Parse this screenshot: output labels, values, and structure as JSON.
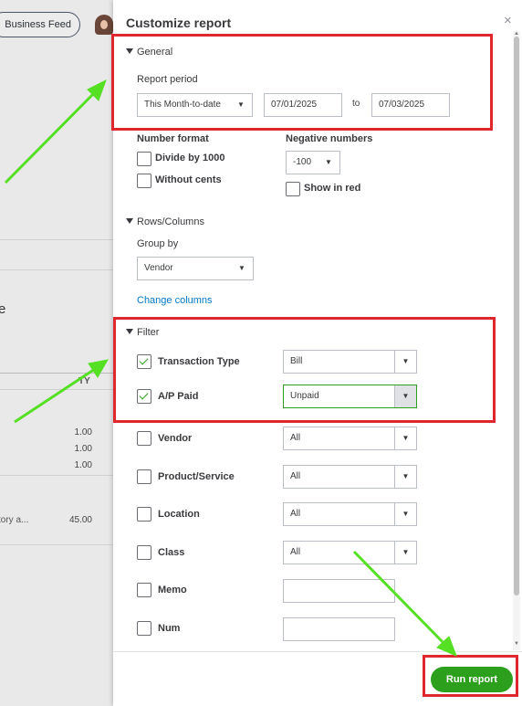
{
  "background": {
    "business_feed_label": "Business Feed",
    "partial_letter": "e",
    "column_header_partial": "TY",
    "row_values": [
      "1.00",
      "1.00",
      "1.00"
    ],
    "row_label_partial": "tory a...",
    "row_value": "45.00"
  },
  "panel": {
    "title": "Customize report",
    "close_label": "×",
    "general": {
      "section_label": "General",
      "report_period_label": "Report period",
      "period_value": "This Month-to-date",
      "from_date": "07/01/2025",
      "to_label": "to",
      "to_date": "07/03/2025",
      "number_format_label": "Number format",
      "divide_label": "Divide by 1000",
      "without_cents_label": "Without cents",
      "negative_numbers_label": "Negative numbers",
      "negative_value": "-100",
      "show_in_red_label": "Show in red"
    },
    "rows_columns": {
      "section_label": "Rows/Columns",
      "group_by_label": "Group by",
      "group_by_value": "Vendor",
      "change_columns_link": "Change columns"
    },
    "filter": {
      "section_label": "Filter",
      "rows": [
        {
          "label": "Transaction Type",
          "value": "Bill",
          "checked": true
        },
        {
          "label": "A/P Paid",
          "value": "Unpaid",
          "checked": true
        },
        {
          "label": "Vendor",
          "value": "All",
          "checked": false
        },
        {
          "label": "Product/Service",
          "value": "All",
          "checked": false
        },
        {
          "label": "Location",
          "value": "All",
          "checked": false
        },
        {
          "label": "Class",
          "value": "All",
          "checked": false
        },
        {
          "label": "Memo",
          "value": "",
          "checked": false
        },
        {
          "label": "Num",
          "value": "",
          "checked": false
        }
      ]
    },
    "run_report_label": "Run report"
  },
  "colors": {
    "accent_green": "#2ca01c",
    "annotation_red": "#e0272e",
    "annotation_arrow": "#55e024",
    "link_blue": "#0077c5"
  }
}
